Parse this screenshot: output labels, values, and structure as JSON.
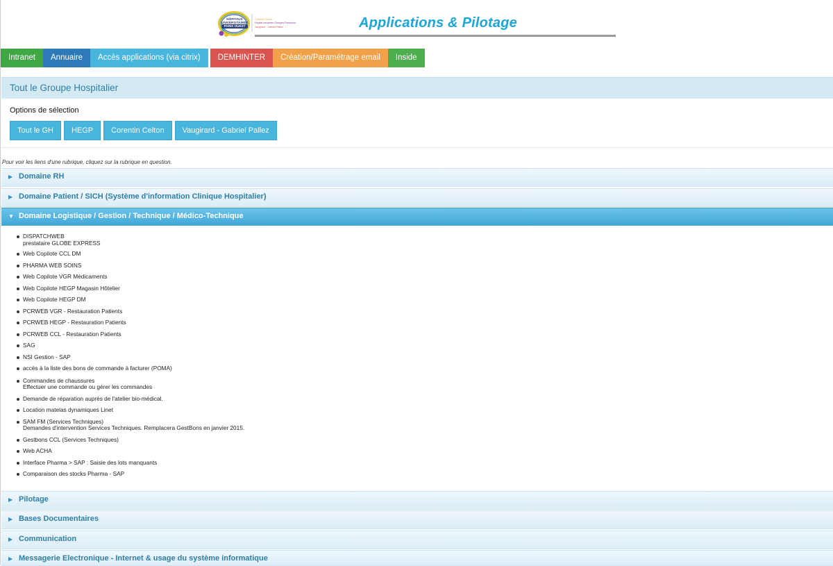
{
  "header": {
    "logo_text_lines": [
      "HÔPITAUX",
      "UNIVERSITAIRES",
      "PARIS OUEST"
    ],
    "logo_side_lines": [
      "Corentin Celton",
      "Hôpital européen Georges Pompidou",
      "Vaugirard - Gabriel Pallez"
    ],
    "app_title": "Applications & Pilotage"
  },
  "nav": [
    {
      "label": "Intranet",
      "color": "#3fa845"
    },
    {
      "label": "Annuaire",
      "color": "#2e7ab8"
    },
    {
      "label": "Accès applications (via citrix)",
      "color": "#48b5dd"
    },
    {
      "label": "DEMHINTER",
      "color": "#d9534f"
    },
    {
      "label": "Création/Paramétrage email",
      "color": "#f0a14a"
    },
    {
      "label": "Inside",
      "color": "#4cae4c"
    }
  ],
  "group_bar": {
    "title": "Tout le Groupe Hospitalier"
  },
  "options": {
    "label": "Options de sélection",
    "buttons": [
      "Tout le GH",
      "HEGP",
      "Corentin Celton",
      "Vaugirard - Gabriel Pallez"
    ]
  },
  "hint": "Pour voir les liens d'une rubrique, cliquez sur la rubrique en question.",
  "sections": [
    {
      "title": "Domaine RH",
      "open": false
    },
    {
      "title": "Domaine Patient / SICH (Système d'information Clinique Hospitalier)",
      "open": false
    },
    {
      "title": "Domaine Logistique / Gestion / Technique / Médico-Technique",
      "open": true
    },
    {
      "title": "Pilotage",
      "open": false
    },
    {
      "title": "Bases Documentaires",
      "open": false
    },
    {
      "title": "Communication",
      "open": false
    },
    {
      "title": "Messagerie Electronique - Internet & usage du système informatique",
      "open": false
    }
  ],
  "open_section_items": [
    {
      "label": "DISPATCHWEB",
      "sub": "prestataire GLOBE EXPRESS"
    },
    {
      "label": "Web Copilote CCL DM",
      "sub": ""
    },
    {
      "label": "PHARMA WEB SOINS",
      "sub": ""
    },
    {
      "label": "Web Copilote VGR Médicaments",
      "sub": ""
    },
    {
      "label": "Web Copilote HEGP Magasin Hôtelier",
      "sub": ""
    },
    {
      "label": "Web Copilote HEGP DM",
      "sub": ""
    },
    {
      "label": "PCRWEB VGR - Restauration Patients",
      "sub": ""
    },
    {
      "label": "PCRWEB HEGP - Restauration Patients",
      "sub": ""
    },
    {
      "label": "PCRWEB CCL - Restauration Patients",
      "sub": ""
    },
    {
      "label": "SAG",
      "sub": ""
    },
    {
      "label": "NSI Gestion - SAP",
      "sub": ""
    },
    {
      "label": "accès à la liste des bons de commande à facturer (POMA)",
      "sub": ""
    },
    {
      "label": "Commandes de chaussures",
      "sub": "Effectuer une commande ou gérer les commandes"
    },
    {
      "label": "Demande de réparation auprès de l'atelier bio-médical.",
      "sub": ""
    },
    {
      "label": "Location matelas dynamiques Linet",
      "sub": ""
    },
    {
      "label": "SAM FM (Services Techniques)",
      "sub": "Demandes d'intervention Services Techniques. Remplacera GestBons en janvier 2015."
    },
    {
      "label": "Gestbons CCL (Services Techniques)",
      "sub": ""
    },
    {
      "label": "Web ACHA",
      "sub": ""
    },
    {
      "label": "Interface Pharma > SAP : Saisie des lots manquants",
      "sub": ""
    },
    {
      "label": "Comparaison des stocks Pharma - SAP",
      "sub": ""
    }
  ],
  "icons": {
    "collapsed": "triangle-right-icon",
    "expanded": "triangle-down-icon"
  }
}
